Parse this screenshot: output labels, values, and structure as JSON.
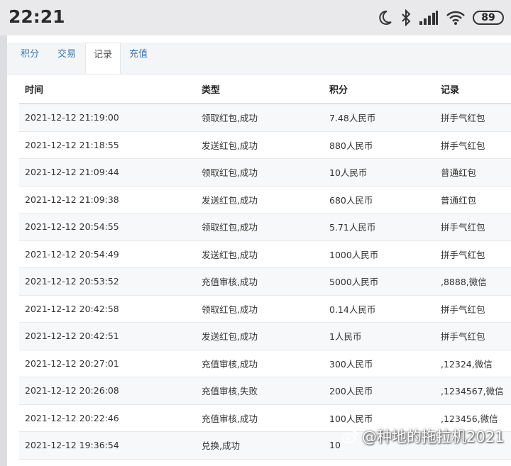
{
  "status": {
    "time": "22:21",
    "battery": "89"
  },
  "tabs": [
    {
      "label": "积分",
      "active": false
    },
    {
      "label": "交易",
      "active": false
    },
    {
      "label": "记录",
      "active": true
    },
    {
      "label": "充值",
      "active": false
    }
  ],
  "table": {
    "headers": [
      "时间",
      "类型",
      "积分",
      "记录"
    ],
    "rows": [
      [
        "2021-12-12 21:19:00",
        "领取红包,成功",
        "7.48人民币",
        "拼手气红包"
      ],
      [
        "2021-12-12 21:18:55",
        "发送红包,成功",
        "880人民币",
        "拼手气红包"
      ],
      [
        "2021-12-12 21:09:44",
        "领取红包,成功",
        "10人民币",
        "普通红包"
      ],
      [
        "2021-12-12 21:09:38",
        "发送红包,成功",
        "680人民币",
        "普通红包"
      ],
      [
        "2021-12-12 20:54:55",
        "领取红包,成功",
        "5.71人民币",
        "拼手气红包"
      ],
      [
        "2021-12-12 20:54:49",
        "发送红包,成功",
        "1000人民币",
        "拼手气红包"
      ],
      [
        "2021-12-12 20:53:52",
        "充值审核,成功",
        "5000人民币",
        ",8888,微信"
      ],
      [
        "2021-12-12 20:42:58",
        "领取红包,成功",
        "0.14人民币",
        "拼手气红包"
      ],
      [
        "2021-12-12 20:42:51",
        "发送红包,成功",
        "1人民币",
        "拼手气红包"
      ],
      [
        "2021-12-12 20:27:01",
        "充值审核,成功",
        "300人民币",
        ",12324,微信"
      ],
      [
        "2021-12-12 20:26:08",
        "充值审核,失败",
        "200人民币",
        ",1234567,微信"
      ],
      [
        "2021-12-12 20:22:46",
        "充值审核,成功",
        "100人民币",
        ",123456,微信"
      ],
      [
        "2021-12-12 19:36:54",
        "兑换,成功",
        "10",
        ""
      ]
    ]
  },
  "watermark": "@种地的拖拉机2021",
  "icons": [
    "moon-icon",
    "bluetooth-icon",
    "signal-icon",
    "wifi-icon",
    "battery-icon",
    "weibo-logo-icon"
  ]
}
